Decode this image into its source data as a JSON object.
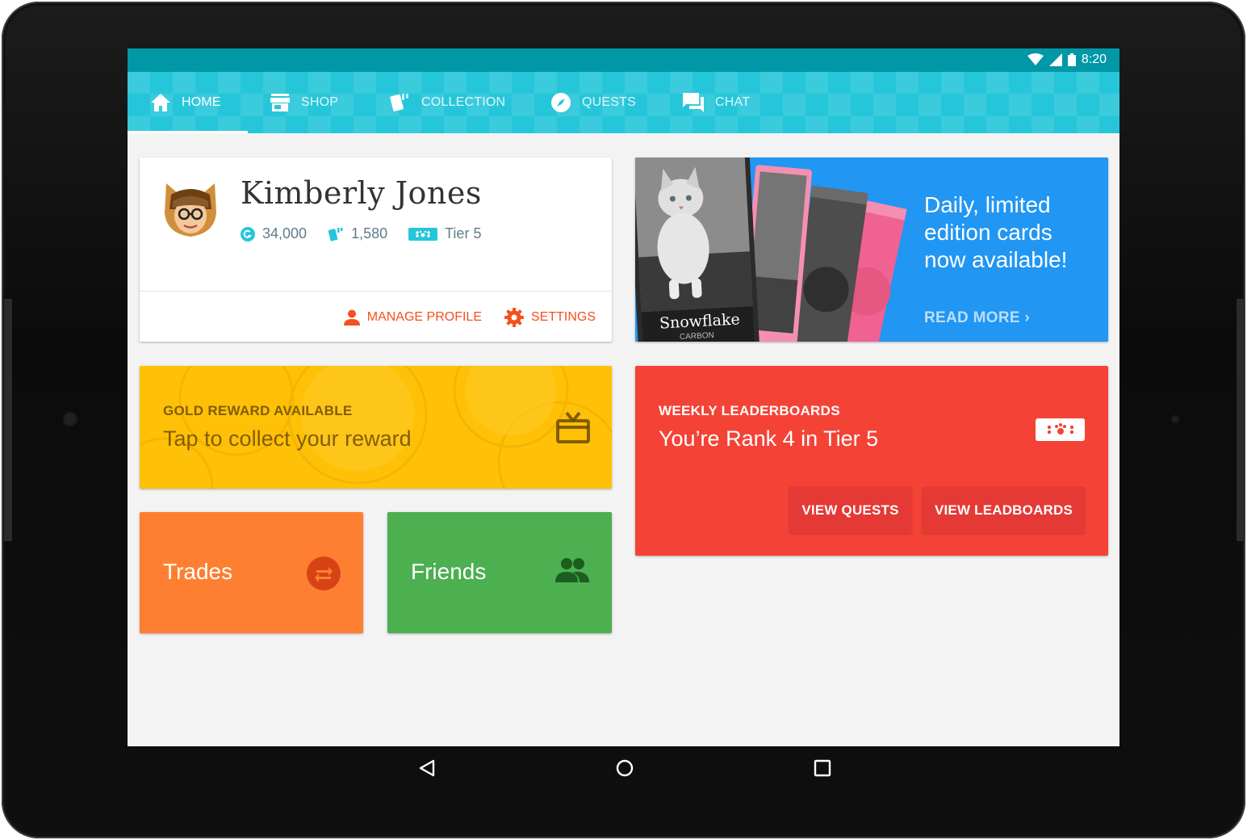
{
  "status_bar": {
    "time": "8:20",
    "icons": [
      "wifi-icon",
      "signal-icon",
      "battery-icon"
    ]
  },
  "tabs": [
    {
      "label": "HOME",
      "icon": "home-icon",
      "active": true
    },
    {
      "label": "SHOP",
      "icon": "store-icon",
      "active": false
    },
    {
      "label": "COLLECTION",
      "icon": "cards-icon",
      "active": false
    },
    {
      "label": "QUESTS",
      "icon": "compass-icon",
      "active": false
    },
    {
      "label": "CHAT",
      "icon": "chat-icon",
      "active": false
    }
  ],
  "profile": {
    "name": "Kimberly Jones",
    "coins": "34,000",
    "cards": "1,580",
    "tier": "Tier 5",
    "manage_label": "MANAGE PROFILE",
    "settings_label": "SETTINGS"
  },
  "promo": {
    "card_name": "Snowflake",
    "card_type": "CARBON",
    "headline": "Daily, limited edition cards now available!",
    "read_more": "READ MORE ›"
  },
  "gold": {
    "kicker": "GOLD REWARD AVAILABLE",
    "message": "Tap to collect your reward"
  },
  "leaderboard": {
    "kicker": "WEEKLY LEADERBOARDS",
    "message": "You’re Rank 4 in Tier 5",
    "view_quests": "VIEW QUESTS",
    "view_leaderboards": "VIEW LEADBOARDS"
  },
  "tiles": {
    "trades": "Trades",
    "friends": "Friends"
  },
  "colors": {
    "appbar": "#26c6da",
    "statusbar": "#0097a7",
    "accent": "#f4511e",
    "promo": "#2196f3",
    "gold": "#ffc107",
    "leaderboard": "#f44336",
    "trades": "#ff7f32",
    "friends": "#4caf50"
  }
}
